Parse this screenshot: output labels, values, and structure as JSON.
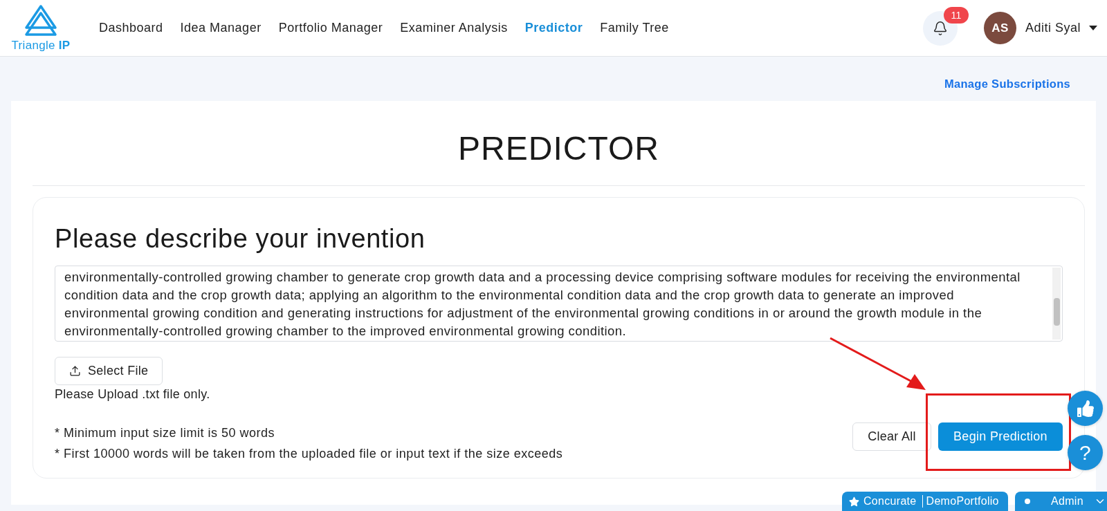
{
  "header": {
    "logo": {
      "text": "Triangle **IP**"
    },
    "nav": [
      {
        "label": "Dashboard",
        "selected": false
      },
      {
        "label": "Idea Manager",
        "selected": false
      },
      {
        "label": "Portfolio Manager",
        "selected": false
      },
      {
        "label": "Examiner Analysis",
        "selected": false
      },
      {
        "label": "Predictor",
        "selected": true
      },
      {
        "label": "Family Tree",
        "selected": false
      }
    ],
    "notifications": {
      "count": "11"
    },
    "user": {
      "initials": "AS",
      "name": "Aditi Syal"
    }
  },
  "subheader": {
    "link": "Manage Subscriptions"
  },
  "page": {
    "title": "PREDICTOR",
    "form": {
      "heading": "Please describe your invention",
      "description": {
        "lines": [
          "environmentally-controlled growing chamber to generate crop growth data and a processing device comprising software modules for receiving the environmental",
          "condition data and the crop growth data; applying an algorithm to the environmental condition data and the crop growth data to generate an improved",
          "environmental growing condition and generating instructions for adjustment of the environmental growing conditions in or around the growth module in the",
          "environmentally-controlled growing chamber to the improved environmental growing condition."
        ]
      },
      "upload": {
        "button": "Select File",
        "hint": "Please Upload .txt file only."
      },
      "notes": [
        "* Minimum input size limit is 50 words",
        "* First 10000 words will be taken from the uploaded file or input text if the size exceeds"
      ],
      "buttons": [
        {
          "label": "Clear All",
          "kind": "secondary"
        },
        {
          "label": "Begin Prediction",
          "kind": "primary"
        }
      ]
    }
  },
  "annotation": {
    "arrow": true,
    "highlight_frame": true
  },
  "floating_actions": [
    {
      "kind": "like"
    },
    {
      "kind": "help",
      "label": "?"
    }
  ],
  "workspace_tab": {
    "name": "Concurate",
    "portfolio": "DemoPortfolio"
  },
  "role_menu": {
    "label": "Admin"
  }
}
